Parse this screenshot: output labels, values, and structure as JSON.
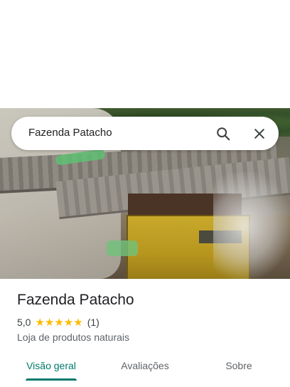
{
  "search": {
    "query": "Fazenda Patacho"
  },
  "place": {
    "name": "Fazenda Patacho",
    "rating": "5,0",
    "stars": "★★★★★",
    "review_count": "(1)",
    "category": "Loja de produtos naturais"
  },
  "tabs": [
    {
      "label": "Visão geral"
    },
    {
      "label": "Avaliações"
    },
    {
      "label": "Sobre"
    }
  ],
  "icons": {
    "search": "search-icon",
    "close": "close-icon"
  },
  "colors": {
    "accent": "#00796b",
    "star": "#fbbc04"
  }
}
